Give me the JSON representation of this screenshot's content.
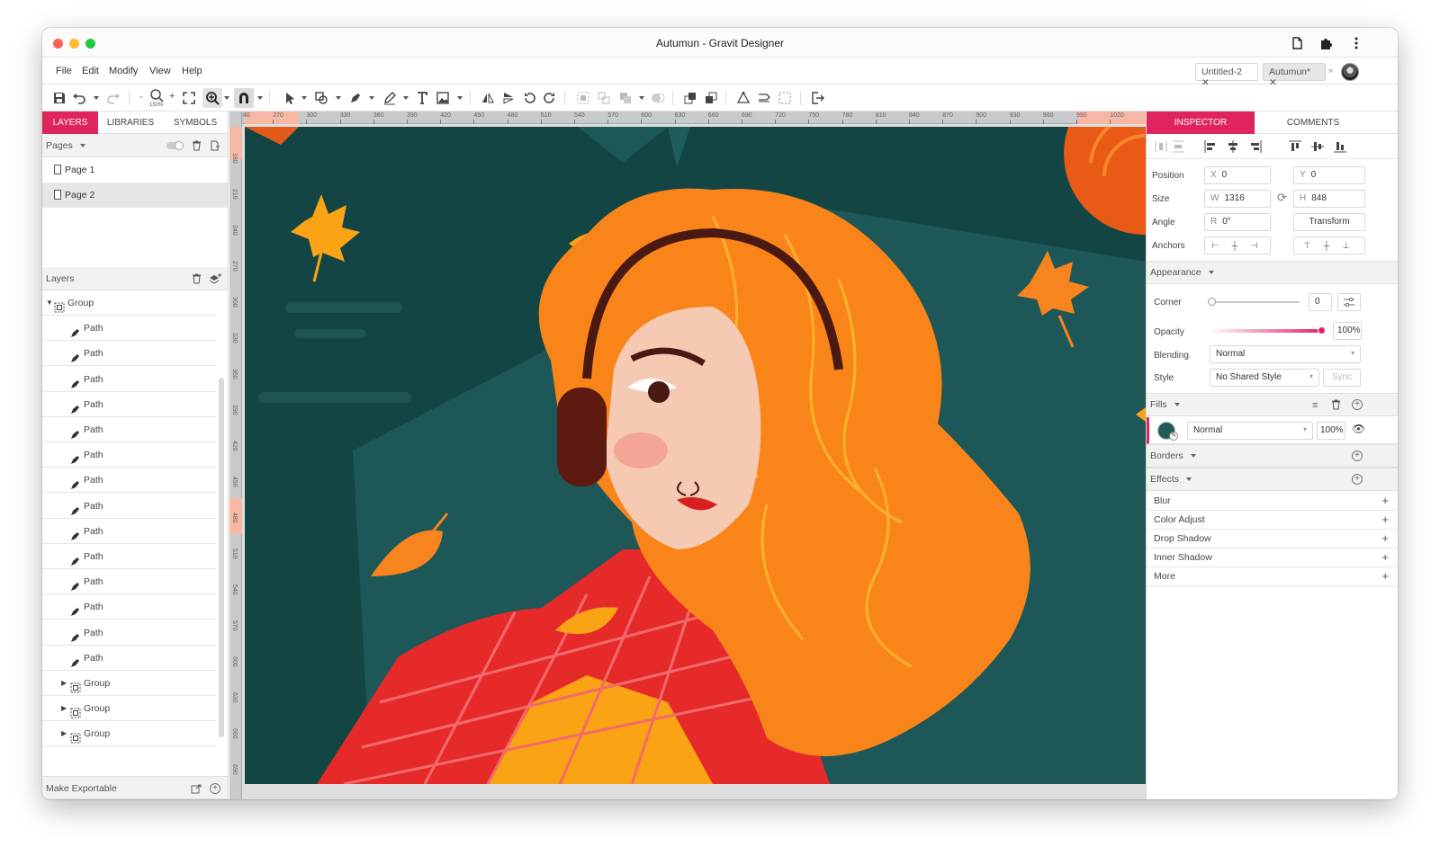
{
  "window": {
    "title": "Autumun - Gravit Designer"
  },
  "menu": [
    "File",
    "Edit",
    "Modify",
    "View",
    "Help"
  ],
  "doc_tabs": [
    {
      "label": "Untitled-2",
      "active": false
    },
    {
      "label": "Autumun*",
      "active": true
    }
  ],
  "toolbar": {
    "zoom_level": "150%"
  },
  "left_panel": {
    "tabs": [
      "LAYERS",
      "LIBRARIES",
      "SYMBOLS"
    ],
    "pages_label": "Pages",
    "pages": [
      "Page 1",
      "Page 2"
    ],
    "selected_page": "Page 2",
    "layers_label": "Layers",
    "layers": [
      {
        "name": "Group",
        "type": "group-open"
      },
      {
        "name": "Path",
        "type": "path"
      },
      {
        "name": "Path",
        "type": "path"
      },
      {
        "name": "Path",
        "type": "path"
      },
      {
        "name": "Path",
        "type": "path"
      },
      {
        "name": "Path",
        "type": "path"
      },
      {
        "name": "Path",
        "type": "path"
      },
      {
        "name": "Path",
        "type": "path"
      },
      {
        "name": "Path",
        "type": "path"
      },
      {
        "name": "Path",
        "type": "path"
      },
      {
        "name": "Path",
        "type": "path"
      },
      {
        "name": "Path",
        "type": "path"
      },
      {
        "name": "Path",
        "type": "path"
      },
      {
        "name": "Path",
        "type": "path"
      },
      {
        "name": "Path",
        "type": "path"
      },
      {
        "name": "Group",
        "type": "group"
      },
      {
        "name": "Group",
        "type": "group"
      },
      {
        "name": "Group",
        "type": "group"
      }
    ],
    "footer_label": "Make Exportable"
  },
  "ruler": {
    "unit": "px",
    "h_ticks": [
      "240",
      "270",
      "300",
      "330",
      "360",
      "390",
      "420",
      "450",
      "480",
      "510",
      "540",
      "570",
      "600",
      "630",
      "660",
      "690",
      "720",
      "750",
      "780",
      "810",
      "840",
      "870",
      "900",
      "930",
      "960",
      "990",
      "1020"
    ],
    "v_ticks": [
      "180",
      "210",
      "240",
      "270",
      "300",
      "330",
      "360",
      "390",
      "420",
      "450",
      "480",
      "510",
      "540",
      "570",
      "600",
      "630",
      "660",
      "690"
    ]
  },
  "inspector": {
    "tabs": [
      "INSPECTOR",
      "COMMENTS"
    ],
    "position_label": "Position",
    "x_prefix": "X",
    "x": "0",
    "y_prefix": "Y",
    "y": "0",
    "size_label": "Size",
    "w_prefix": "W",
    "w": "1316",
    "h_prefix": "H",
    "h": "848",
    "angle_label": "Angle",
    "r_prefix": "R",
    "angle": "0°",
    "transform_label": "Transform",
    "anchors_label": "Anchors",
    "appearance_label": "Appearance",
    "corner_label": "Corner",
    "corner_value": "0",
    "opacity_label": "Opacity",
    "opacity_value": "100%",
    "opacity_level": 1.0,
    "blending_label": "Blending",
    "blending_value": "Normal",
    "style_label": "Style",
    "style_value": "No Shared Style",
    "sync_label": "Sync",
    "fills_label": "Fills",
    "fill_color": "#1f5a5a",
    "fill_blend": "Normal",
    "fill_opacity": "100%",
    "borders_label": "Borders",
    "effects_label": "Effects",
    "effects": [
      "Blur",
      "Color Adjust",
      "Drop Shadow",
      "Inner Shadow",
      "More"
    ]
  },
  "colors": {
    "accent": "#e0245e",
    "canvas_bg": "#134545",
    "hair": "#f9841a"
  }
}
